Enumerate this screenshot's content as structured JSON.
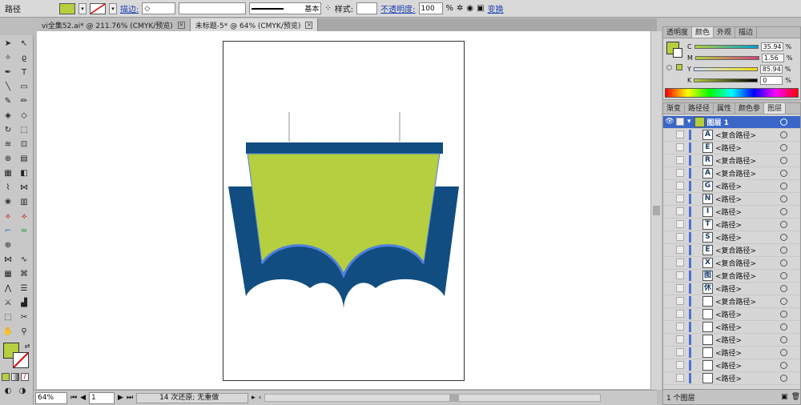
{
  "toolbar": {
    "label_path": "路径",
    "stroke_label": "描边:",
    "profile_label": "基本",
    "style_label": "样式:",
    "opacity_label": "不透明度:",
    "opacity_value": "100",
    "percent": "%",
    "transform_label": "变换"
  },
  "tabs": [
    {
      "label": "vi全集52.ai* @ 211.76% (CMYK/预览)"
    },
    {
      "label": "未标题-5* @ 64% (CMYK/预览)"
    }
  ],
  "status": {
    "zoom": "64%",
    "page": "1",
    "message": "14 次还原; 无重做"
  },
  "color_panel": {
    "tabs": [
      "透明度",
      "颜色",
      "外观",
      "描边"
    ],
    "active_tab": "颜色",
    "channels": [
      {
        "name": "C",
        "value": "35.94"
      },
      {
        "name": "M",
        "value": "1.56"
      },
      {
        "name": "Y",
        "value": "85.94"
      },
      {
        "name": "K",
        "value": "0"
      }
    ],
    "percent": "%"
  },
  "layers_panel": {
    "tabs": [
      "渐变",
      "路径径",
      "属性",
      "颜色参",
      "图层"
    ],
    "active_tab": "图层",
    "top_layer": "图层 1",
    "rows": [
      {
        "icon": "A",
        "label": "<复合路径>"
      },
      {
        "icon": "E",
        "label": "<路径>"
      },
      {
        "icon": "R",
        "label": "<复合路径>"
      },
      {
        "icon": "A",
        "label": "<复合路径>"
      },
      {
        "icon": "G",
        "label": "<路径>"
      },
      {
        "icon": "N",
        "label": "<路径>"
      },
      {
        "icon": "I",
        "label": "<路径>"
      },
      {
        "icon": "T",
        "label": "<路径>"
      },
      {
        "icon": "S",
        "label": "<路径>"
      },
      {
        "icon": "E",
        "label": "<复合路径>"
      },
      {
        "icon": "X",
        "label": "<复合路径>"
      },
      {
        "icon": "图",
        "label": "<复合路径>"
      },
      {
        "icon": "休",
        "label": "<路径>"
      },
      {
        "icon": "",
        "label": "<复合路径>"
      },
      {
        "icon": "",
        "label": "<路径>"
      },
      {
        "icon": "",
        "label": "<路径>"
      },
      {
        "icon": "",
        "label": "<路径>"
      },
      {
        "icon": "",
        "label": "<路径>"
      },
      {
        "icon": "",
        "label": "<路径>"
      },
      {
        "icon": "",
        "label": "<路径>"
      }
    ],
    "footer": "1 个图层"
  },
  "colors": {
    "green": "#b5cf3e",
    "navy": "#114d80",
    "selection": "#4f7fe0"
  }
}
